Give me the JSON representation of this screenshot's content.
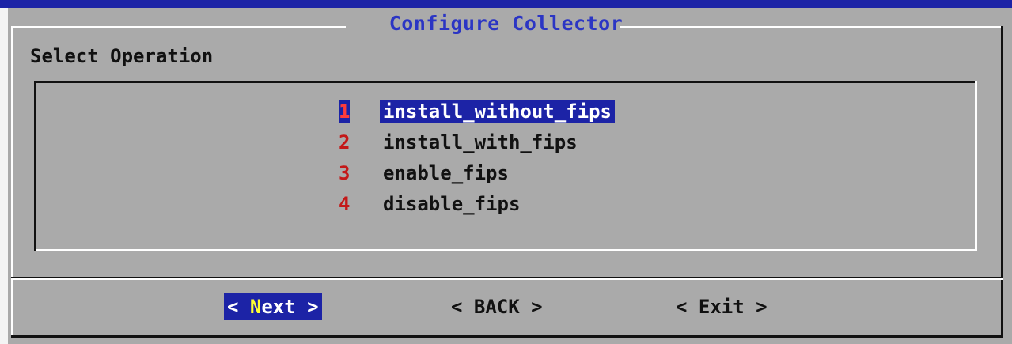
{
  "dialog": {
    "title": "Configure Collector",
    "prompt": "Select Operation"
  },
  "menu": {
    "items": [
      {
        "tag": "1",
        "label": "install_without_fips",
        "selected": true
      },
      {
        "tag": "2",
        "label": "install_with_fips",
        "selected": false
      },
      {
        "tag": "3",
        "label": "enable_fips",
        "selected": false
      },
      {
        "tag": "4",
        "label": "disable_fips",
        "selected": false
      }
    ]
  },
  "buttons": {
    "next": {
      "open": "< ",
      "hotkey": "N",
      "rest": "ext",
      "close": " >"
    },
    "back": {
      "label": "< BACK >"
    },
    "exit": {
      "label": "< Exit >"
    }
  },
  "colors": {
    "background": "#aaaaaa",
    "title": "#2b35c4",
    "selection": "#1c23a6",
    "tag": "#c41818",
    "hotkey": "#ffff33"
  }
}
